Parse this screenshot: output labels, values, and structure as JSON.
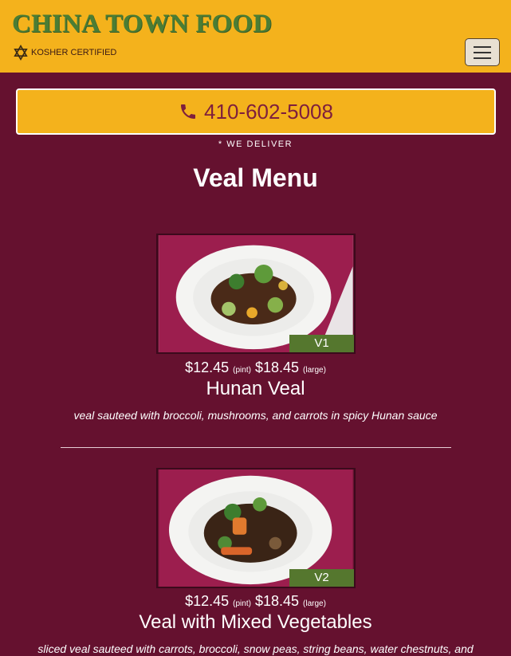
{
  "header": {
    "brand": "CHINA TOWN FOOD",
    "kosher_label": "KOSHER CERTIFIED",
    "kosher_icon": "star-of-david-icon",
    "menu_icon": "hamburger-menu-icon"
  },
  "contact": {
    "phone": "410-602-5008",
    "phone_icon": "phone-icon",
    "deliver_note": "* WE DELIVER"
  },
  "page": {
    "title": "Veal Menu"
  },
  "items": [
    {
      "code": "V1",
      "price_pint": "$12.45",
      "pint_label": "(pint)",
      "price_large": "$18.45",
      "large_label": "(large)",
      "name": "Hunan Veal",
      "description": "veal sauteed with broccoli, mushrooms, and carrots in spicy Hunan sauce"
    },
    {
      "code": "V2",
      "price_pint": "$12.45",
      "pint_label": "(pint)",
      "price_large": "$18.45",
      "large_label": "(large)",
      "name": "Veal with Mixed Vegetables",
      "description": "sliced veal sauteed with carrots, broccoli, snow peas, string beans, water chestnuts, and"
    }
  ],
  "colors": {
    "background": "#65112f",
    "header": "#f4b21c",
    "brand": "#4b7d34",
    "phone_text": "#7e1f3d",
    "code_badge": "#55772e"
  }
}
